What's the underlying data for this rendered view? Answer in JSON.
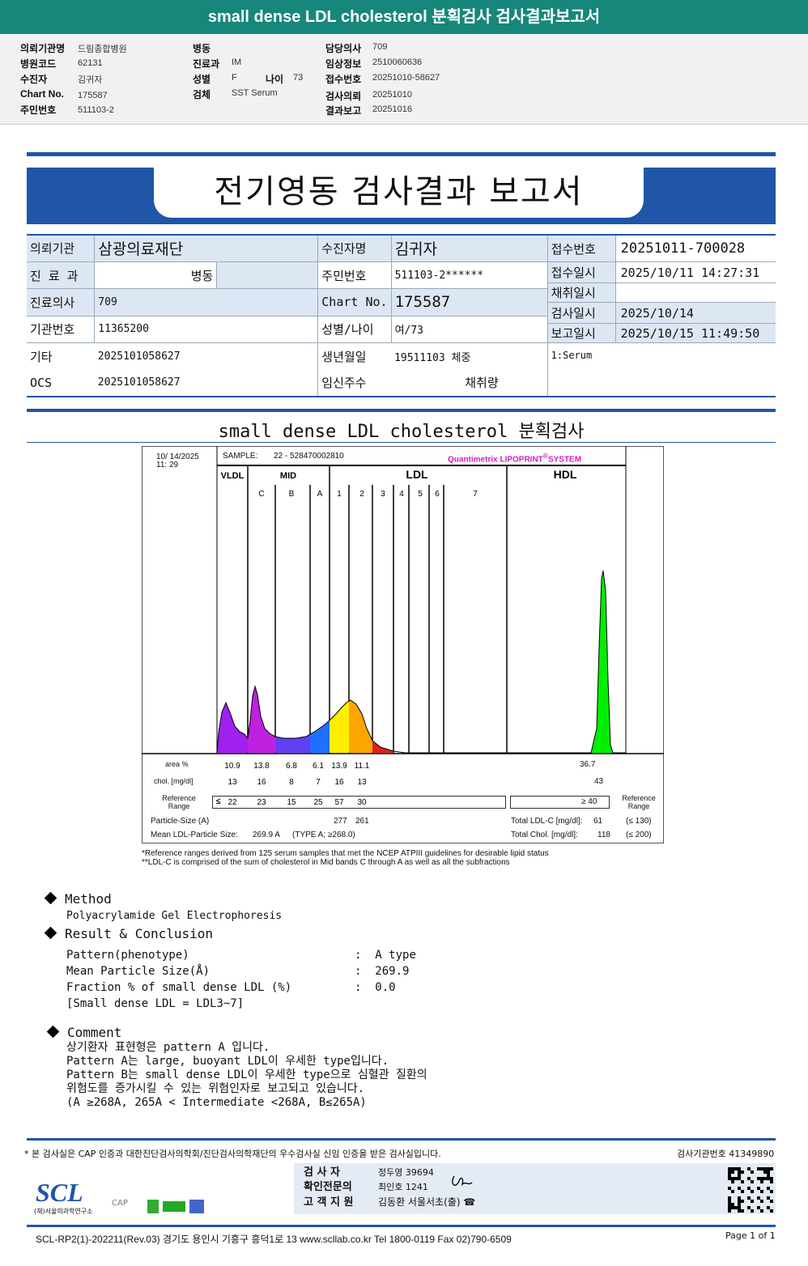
{
  "title": "small dense LDL cholesterol 분획검사 검사결과보고서",
  "info": {
    "col1": [
      {
        "label": "의뢰기관명",
        "value": "드림종합병원"
      },
      {
        "label": "병원코드",
        "value": "62131"
      },
      {
        "label": "수진자",
        "value": "김귀자"
      },
      {
        "label": "Chart No.",
        "value": "175587"
      },
      {
        "label": "주민번호",
        "value": "511103-2"
      }
    ],
    "col2": [
      {
        "label": "병동",
        "value": ""
      },
      {
        "label": "진료과",
        "value": "IM"
      },
      {
        "label": "성별",
        "value": "F"
      },
      {
        "label": "검체",
        "value": "SST Serum"
      }
    ],
    "age_label": "나이",
    "age": "73",
    "col3": [
      {
        "label": "담당의사",
        "value": "709"
      },
      {
        "label": "임상정보",
        "value": "2510060636"
      },
      {
        "label": "접수번호",
        "value": "20251010-58627"
      },
      {
        "label": "검사의뢰",
        "value": "20251010"
      },
      {
        "label": "결과보고",
        "value": "20251016"
      }
    ]
  },
  "banner": "전기영동 검사결과 보고서",
  "patient": {
    "r1": [
      "의뢰기관",
      "삼광의료재단",
      "수진자명",
      "김귀자",
      "접수번호",
      "20251011-700028"
    ],
    "r2": [
      "진 료 과",
      "병동",
      "주민번호",
      "511103-2******",
      "접수일시",
      "2025/10/11 14:27:31"
    ],
    "r2b": [
      "채취일시",
      ""
    ],
    "r3": [
      "진료의사",
      "709",
      "Chart No.",
      "175587",
      "검사일시",
      "2025/10/14"
    ],
    "r4": [
      "기관번호",
      "11365200",
      "성별/나이",
      "여/73",
      "보고일시",
      "2025/10/15 11:49:50"
    ],
    "r5": [
      "기타",
      "2025101058627",
      "생년월일",
      "19511103 체중",
      "1:Serum"
    ],
    "r6": [
      "OCS",
      "2025101058627",
      "임신주수",
      "채취량"
    ]
  },
  "section_title": "small dense LDL cholesterol 분획검사",
  "lipoprint": {
    "date": "10/ 14/2025",
    "time": "11: 29",
    "sample_label": "SAMPLE:",
    "sample": "22 - 528470002810",
    "brand": "Quantimetrix LIPOPRINT",
    "brand_sup": "®",
    "brand_tail": "SYSTEM",
    "groups": [
      "VLDL",
      "MID",
      "LDL",
      "HDL"
    ],
    "bands": [
      "C",
      "B",
      "A",
      "1",
      "2",
      "3",
      "4",
      "5",
      "6",
      "7"
    ],
    "colors": {
      "vldl": "#a020f0",
      "midc": "#c020e0",
      "midb": "#6040f0",
      "mida": "#2070ff",
      "ldl1": "#ffee00",
      "ldl2": "#ffa500",
      "ldl3": "#e02020",
      "hdl": "#00ee00"
    },
    "row_area_label": "area %",
    "area": [
      "10.9",
      "13.8",
      "6.8",
      "6.1",
      "13.9",
      "11.1"
    ],
    "area_hdl": "36.7",
    "row_chol_label": "chol. [mg/dl]",
    "chol": [
      "13",
      "16",
      "8",
      "7",
      "16",
      "13"
    ],
    "chol_hdl": "43",
    "ref_label": "Reference Range",
    "ref_le": "≤",
    "ref": [
      "22",
      "23",
      "15",
      "25",
      "57",
      "30"
    ],
    "ref_hdl": "≥  40",
    "particle_label": "Particle-Size (A)",
    "particle": [
      "277",
      "261"
    ],
    "mean_label": "Mean LDL-Particle Size:",
    "mean": "269.9  A",
    "mean_type": "(TYPE A; ≥268.0)",
    "total_ldl_label": "Total LDL-C [mg/dl]:",
    "total_ldl": "61",
    "total_ldl_ref": "(≤ 130)",
    "total_chol_label": "Total Chol. [mg/dl]:",
    "total_chol": "118",
    "total_chol_ref": "(≤ 200)",
    "note1": "*Reference ranges derived from 125 serum samples that met the NCEP ATPIII guidelines for desirable lipid status",
    "note2": "**LDL-C is comprised of the sum of cholesterol in Mid bands C through A as well as all the subfractions"
  },
  "method": {
    "title": "Method",
    "text": "Polyacrylamide Gel Electrophoresis"
  },
  "result": {
    "title": "Result & Conclusion",
    "rows": [
      {
        "k": "Pattern(phenotype)",
        "v": "A type"
      },
      {
        "k": "Mean Particle Size(Å)",
        "v": "269.9"
      },
      {
        "k": "Fraction % of small dense LDL (%)",
        "v": "0.0"
      }
    ],
    "note": "[Small dense LDL = LDL3~7]"
  },
  "comment": {
    "title": "Comment",
    "lines": [
      "상기환자 표현형은 pattern A 입니다.",
      "Pattern A는 large, buoyant LDL이 우세한 type입니다.",
      "Pattern B는 small dense LDL이 우세한 type으로 심혈관 질환의",
      "위험도를 증가시킬 수 있는 위험인자로 보고되고 있습니다.",
      "(A ≥268A, 265A < Intermediate <268A, B≤265A)"
    ]
  },
  "footer": {
    "cert": "* 본 검사실은 CAP 인증과 대한진단검사의학회/진단검사의학재단의 우수검사실 신임 인증을 받은 검사실입니다.",
    "inst": "검사기관번호 41349890",
    "sign": [
      {
        "k": "검    사    자",
        "v": "정두영 39694"
      },
      {
        "k": "확인전문의",
        "v": "최인호 1241"
      },
      {
        "k": "고 객 지 원",
        "v": "김동환 서울서초(출) ☎"
      }
    ],
    "logo": "SCL",
    "logo_sub": "(재)서울의과학연구소",
    "cap": "CAP",
    "address": "SCL-RP2(1)-202211(Rev.03)  경기도 용인시 기흥구 흥덕1로 13  www.scllab.co.kr   Tel 1800-0119    Fax 02)790-6509",
    "page": "Page 1 of 1"
  }
}
